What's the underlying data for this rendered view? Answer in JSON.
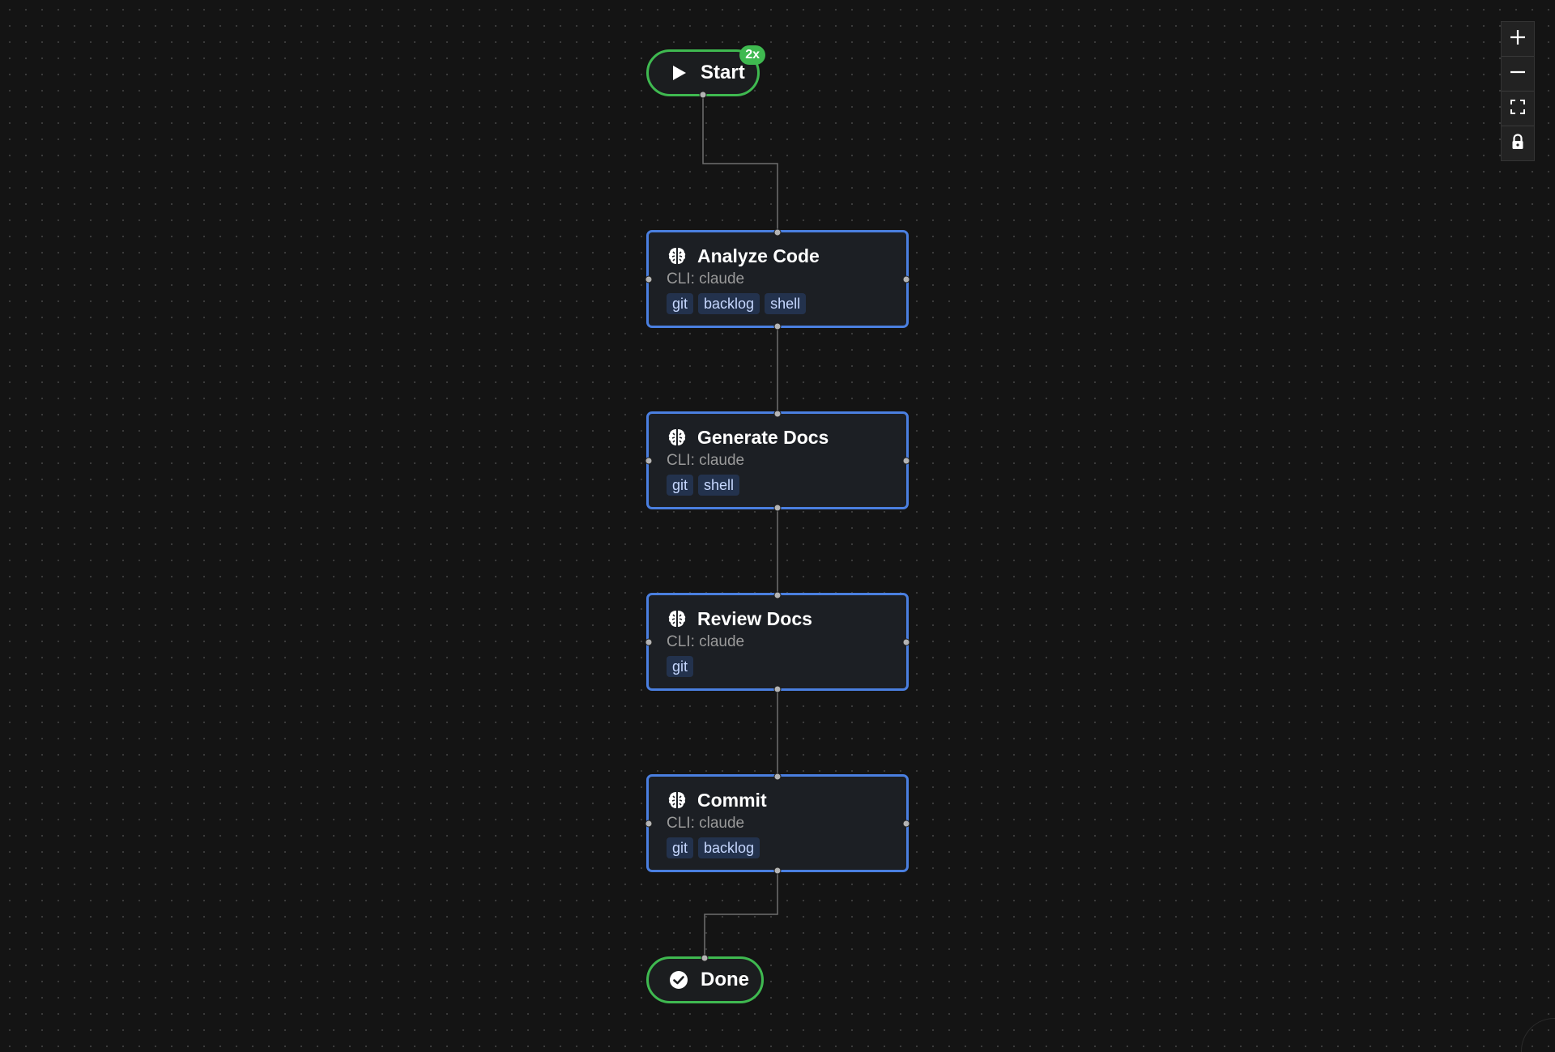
{
  "colors": {
    "background": "#141414",
    "task_border": "#4a7fe0",
    "terminal_border": "#3fb950",
    "tag_bg": "#23324d",
    "tag_text": "#c7d8ff",
    "edge": "#6e6e6e"
  },
  "start": {
    "label": "Start",
    "icon": "play-icon",
    "badge": "2x"
  },
  "tasks": [
    {
      "title": "Analyze Code",
      "icon": "brain-icon",
      "cli": "CLI: claude",
      "tags": [
        "git",
        "backlog",
        "shell"
      ]
    },
    {
      "title": "Generate Docs",
      "icon": "brain-icon",
      "cli": "CLI: claude",
      "tags": [
        "git",
        "shell"
      ]
    },
    {
      "title": "Review Docs",
      "icon": "brain-icon",
      "cli": "CLI: claude",
      "tags": [
        "git"
      ]
    },
    {
      "title": "Commit",
      "icon": "brain-icon",
      "cli": "CLI: claude",
      "tags": [
        "git",
        "backlog"
      ]
    }
  ],
  "done": {
    "label": "Done",
    "icon": "check-circle-icon"
  },
  "controls": [
    {
      "name": "zoom-in",
      "icon": "plus-icon"
    },
    {
      "name": "zoom-out",
      "icon": "minus-icon"
    },
    {
      "name": "fit-view",
      "icon": "fit-view-icon"
    },
    {
      "name": "lock",
      "icon": "lock-icon"
    }
  ]
}
